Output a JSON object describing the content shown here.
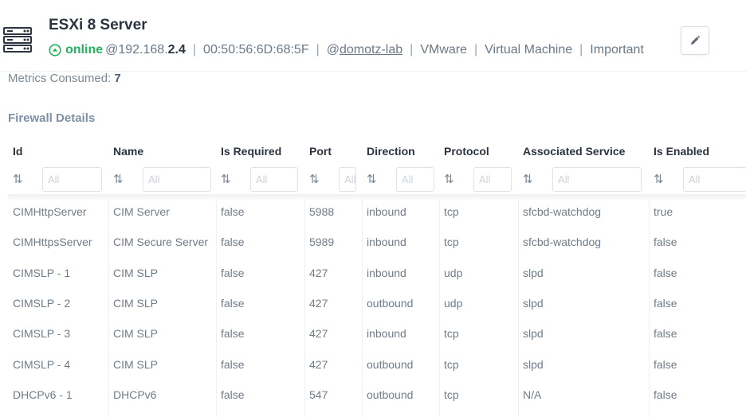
{
  "device": {
    "title": "ESXi 8 Server",
    "status": "online",
    "ip_prefix": "@192.168.",
    "ip_suffix": "2.4",
    "mac": "00:50:56:6D:68:5F",
    "agent": "@domotz-lab",
    "vendor": "VMware",
    "type": "Virtual Machine",
    "importance": "Important",
    "status_color": "#22b45a"
  },
  "metrics": {
    "label": "Metrics Consumed:",
    "value": "7"
  },
  "section": {
    "title": "Firewall Details"
  },
  "table": {
    "columns": [
      "Id",
      "Name",
      "Is Required",
      "Port",
      "Direction",
      "Protocol",
      "Associated Service",
      "Is Enabled"
    ],
    "filter_placeholder": "All",
    "sort_icon": "sort-arrows-icon",
    "rows": [
      [
        "CIMHttpServer",
        "CIM Server",
        "false",
        "5988",
        "inbound",
        "tcp",
        "sfcbd-watchdog",
        "true"
      ],
      [
        "CIMHttpsServer",
        "CIM Secure Server",
        "false",
        "5989",
        "inbound",
        "tcp",
        "sfcbd-watchdog",
        "false"
      ],
      [
        "CIMSLP - 1",
        "CIM SLP",
        "false",
        "427",
        "inbound",
        "udp",
        "slpd",
        "false"
      ],
      [
        "CIMSLP - 2",
        "CIM SLP",
        "false",
        "427",
        "outbound",
        "udp",
        "slpd",
        "false"
      ],
      [
        "CIMSLP - 3",
        "CIM SLP",
        "false",
        "427",
        "inbound",
        "tcp",
        "slpd",
        "false"
      ],
      [
        "CIMSLP - 4",
        "CIM SLP",
        "false",
        "427",
        "outbound",
        "tcp",
        "slpd",
        "false"
      ],
      [
        "DHCPv6 - 1",
        "DHCPv6",
        "false",
        "547",
        "outbound",
        "tcp",
        "N/A",
        "false"
      ]
    ]
  }
}
